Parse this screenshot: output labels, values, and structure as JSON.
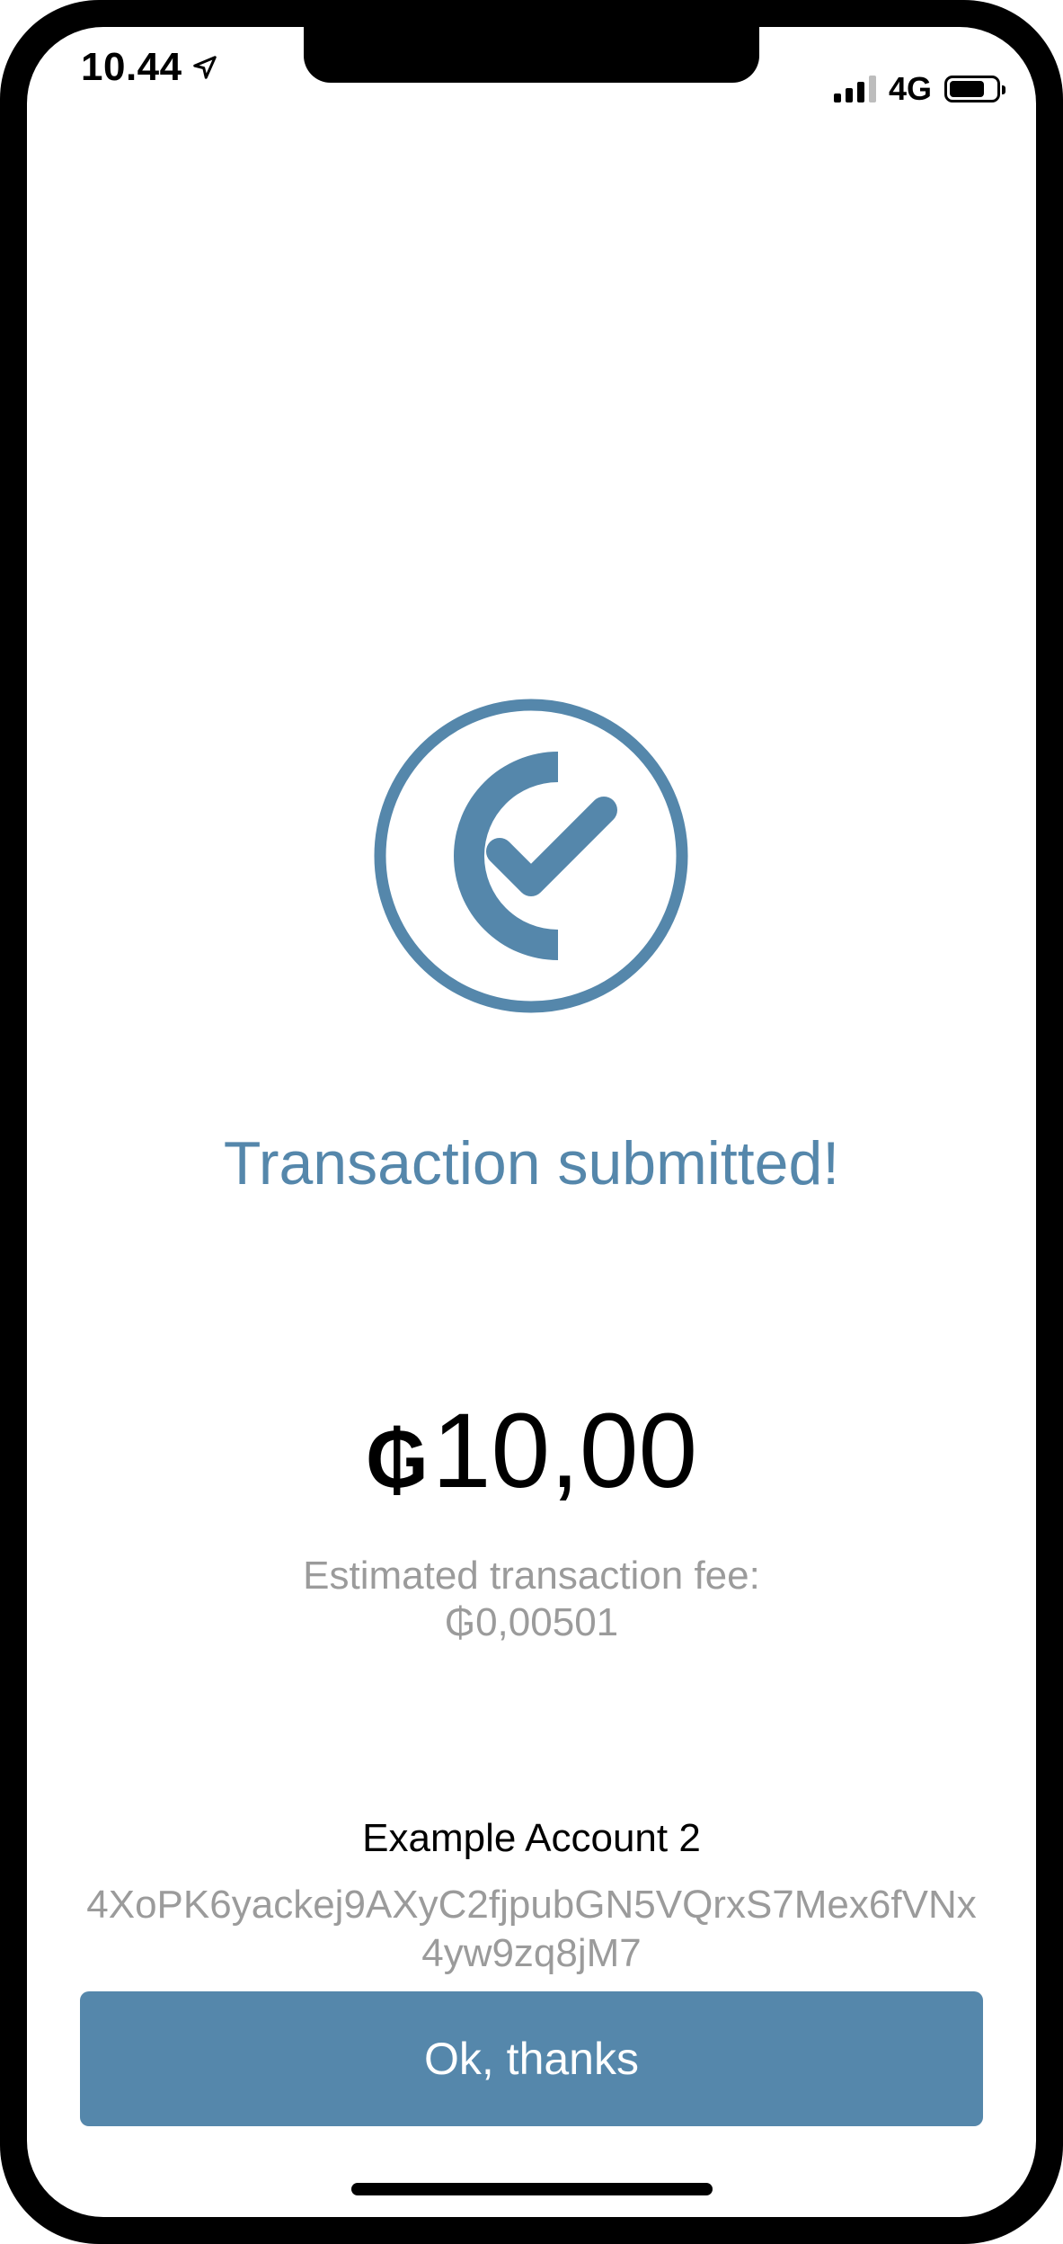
{
  "status_bar": {
    "time": "10.44",
    "network": "4G",
    "signal_bars": 4,
    "battery_level": 0.75
  },
  "icon": {
    "name": "check-circle-icon",
    "color": "#5587ab"
  },
  "title": "Transaction submitted!",
  "amount": {
    "currency_symbol": "₲",
    "value": "10,00"
  },
  "fee": {
    "label": "Estimated transaction fee:",
    "value": "₲0,00501"
  },
  "account": {
    "name": "Example Account 2",
    "address": "4XoPK6yackej9AXyC2fjpubGN5VQrxS7Mex6fVNx4yw9zq8jM7"
  },
  "button": {
    "label": "Ok, thanks",
    "color": "#5587ab"
  }
}
